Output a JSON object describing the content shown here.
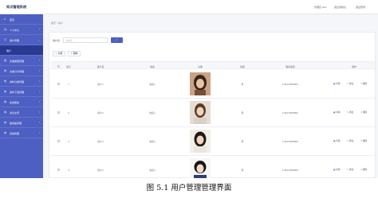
{
  "app": {
    "title": "知识管理系统"
  },
  "topbar": {
    "links": [
      "管理员 abo",
      "退出到前台",
      "退出登录"
    ]
  },
  "sidebar": {
    "items": [
      {
        "icon": "home-icon",
        "glyph": "⌂",
        "label": "首页",
        "chevron": ""
      },
      {
        "icon": "user-icon",
        "glyph": "☺",
        "label": "个人中心",
        "chevron": "›"
      },
      {
        "icon": "users-icon",
        "glyph": "☷",
        "label": "用户管理",
        "chevron": "⌄"
      },
      {
        "icon": "user-icon",
        "glyph": "",
        "label": "用户",
        "chevron": ""
      },
      {
        "icon": "folder-icon",
        "glyph": "▤",
        "label": "文章类型管理",
        "chevron": "›"
      },
      {
        "icon": "folder-icon",
        "glyph": "▤",
        "label": "文章分享管理",
        "chevron": "›"
      },
      {
        "icon": "folder-icon",
        "glyph": "▤",
        "label": "资料分类管理",
        "chevron": "›"
      },
      {
        "icon": "folder-icon",
        "glyph": "▤",
        "label": "资料下载管理",
        "chevron": "›"
      },
      {
        "icon": "folder-icon",
        "glyph": "▤",
        "label": "在线留言",
        "chevron": "›"
      },
      {
        "icon": "folder-icon",
        "glyph": "▤",
        "label": "论坛交流",
        "chevron": "›"
      },
      {
        "icon": "folder-icon",
        "glyph": "▤",
        "label": "留言板管理",
        "chevron": "›"
      },
      {
        "icon": "folder-icon",
        "glyph": "▤",
        "label": "系统管理",
        "chevron": "›"
      }
    ]
  },
  "breadcrumb": {
    "text": "首页 / 用户"
  },
  "search": {
    "label": "用户名",
    "placeholder": "用户名",
    "button_icon": "⌕"
  },
  "actions": [
    {
      "icon": "+",
      "label": "新增"
    },
    {
      "icon": "✕",
      "label": "删除"
    }
  ],
  "table": {
    "headers": [
      "索引",
      "用户名",
      "姓名",
      "头像",
      "性别",
      "联系电话",
      "操作"
    ],
    "rows": [
      {
        "index": "1",
        "username": "用户1",
        "name": "姓名1",
        "gender": "男",
        "phone": "13823888881"
      },
      {
        "index": "2",
        "username": "用户2",
        "name": "姓名2",
        "gender": "男",
        "phone": "13823888882"
      },
      {
        "index": "3",
        "username": "用户3",
        "name": "姓名3",
        "gender": "男",
        "phone": "13823888883"
      },
      {
        "index": "4",
        "username": "用户4",
        "name": "姓名4",
        "gender": "男",
        "phone": "13823888884"
      }
    ],
    "row_actions": [
      "详情",
      "修改",
      "删除"
    ]
  },
  "caption": "图 5.1  用户管理管理界面",
  "colors": {
    "accent": "#4d5fc2",
    "sidebar": "#4d5fc2",
    "danger": "#e05656"
  }
}
